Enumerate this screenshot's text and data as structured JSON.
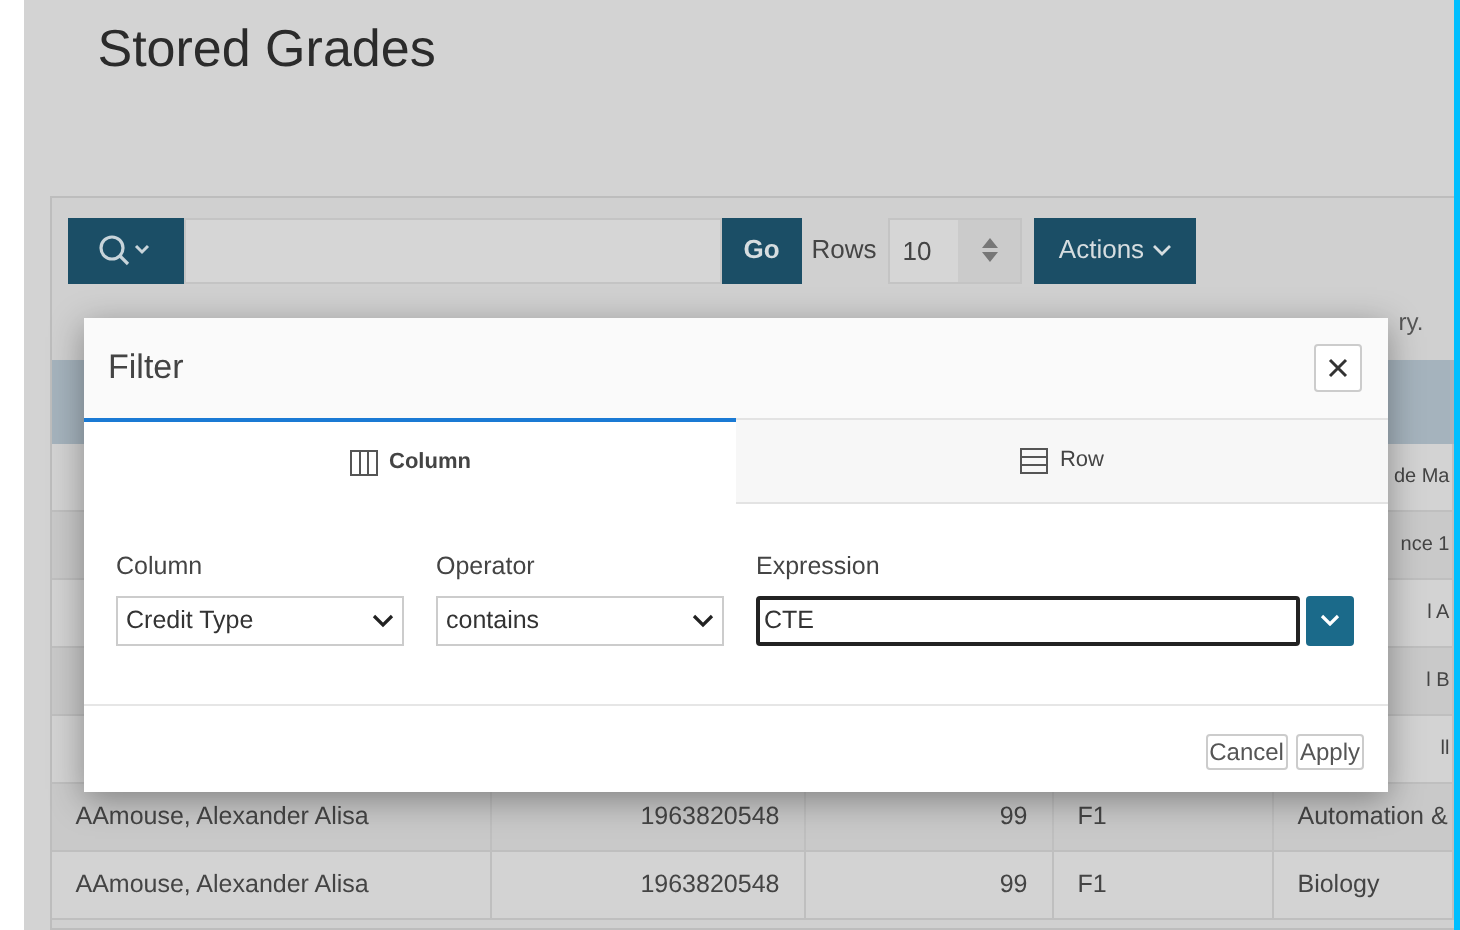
{
  "page": {
    "title": "Stored Grades"
  },
  "toolbar": {
    "go": "Go",
    "rows_label": "Rows",
    "rows_value": "10",
    "actions": "Actions"
  },
  "report_note": "ry.",
  "table": {
    "rows": [
      {
        "cells": [
          "",
          "",
          "",
          "",
          "de Ma"
        ]
      },
      {
        "cells": [
          "",
          "",
          "",
          "",
          "nce 1"
        ]
      },
      {
        "cells": [
          "",
          "",
          "",
          "",
          "l A"
        ]
      },
      {
        "cells": [
          "",
          "",
          "",
          "",
          "l B"
        ]
      },
      {
        "cells": [
          "",
          "",
          "",
          "",
          "ll"
        ]
      },
      {
        "cells": [
          "AAmouse, Alexander Alisa",
          "1963820548",
          "99",
          "F1",
          "Automation &"
        ]
      },
      {
        "cells": [
          "AAmouse, Alexander Alisa",
          "1963820548",
          "99",
          "F1",
          "Biology"
        ]
      }
    ]
  },
  "dialog": {
    "title": "Filter",
    "tabs": [
      {
        "label": "Column",
        "kind": "column",
        "selected": true
      },
      {
        "label": "Row",
        "kind": "row",
        "selected": false
      }
    ],
    "fields": [
      {
        "label": "Column",
        "kind": "select",
        "value": "Credit Type"
      },
      {
        "label": "Operator",
        "kind": "select",
        "value": "contains"
      },
      {
        "label": "Expression",
        "kind": "text",
        "value": "CTE"
      }
    ],
    "buttons": [
      "Cancel",
      "Apply"
    ]
  }
}
